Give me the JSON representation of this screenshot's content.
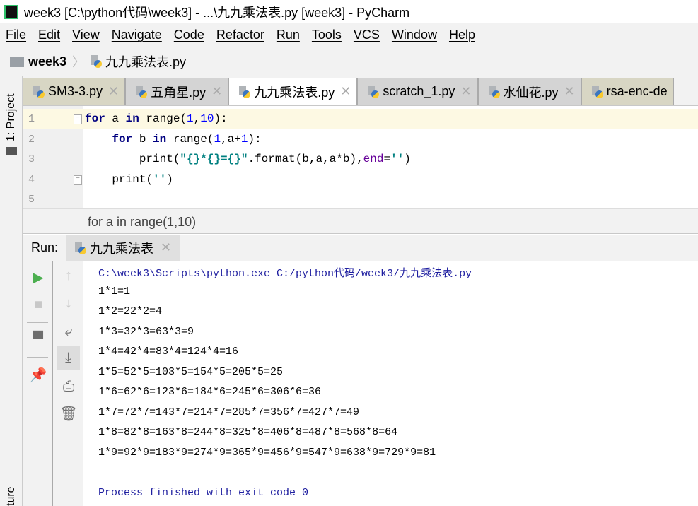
{
  "window": {
    "title": "week3 [C:\\python代码\\week3] - ...\\九九乘法表.py [week3] - PyCharm",
    "logo": "PC"
  },
  "menu": [
    "File",
    "Edit",
    "View",
    "Navigate",
    "Code",
    "Refactor",
    "Run",
    "Tools",
    "VCS",
    "Window",
    "Help"
  ],
  "breadcrumb": {
    "project": "week3",
    "file": "九九乘法表.py"
  },
  "left_strip": {
    "project": "1: Project",
    "structure": "ture"
  },
  "tabs": [
    {
      "label": "SM3-3.py"
    },
    {
      "label": "五角星.py"
    },
    {
      "label": "九九乘法表.py",
      "active": true
    },
    {
      "label": "scratch_1.py"
    },
    {
      "label": "水仙花.py"
    },
    {
      "label": "rsa-enc-de"
    }
  ],
  "editor": {
    "line_numbers": [
      "1",
      "2",
      "3",
      "4",
      "5"
    ]
  },
  "code_breadcrumb": "for a in range(1,10)",
  "run": {
    "label": "Run:",
    "tab": "九九乘法表"
  },
  "console": {
    "command": "C:\\week3\\Scripts\\python.exe C:/python代码/week3/九九乘法表.py",
    "lines": [
      "1*1=1",
      "1*2=22*2=4",
      "1*3=32*3=63*3=9",
      "1*4=42*4=83*4=124*4=16",
      "1*5=52*5=103*5=154*5=205*5=25",
      "1*6=62*6=123*6=184*6=245*6=306*6=36",
      "1*7=72*7=143*7=214*7=285*7=356*7=427*7=49",
      "1*8=82*8=163*8=244*8=325*8=406*8=487*8=568*8=64",
      "1*9=92*9=183*9=274*9=365*9=456*9=547*9=638*9=729*9=81"
    ],
    "exit": "Process finished with exit code 0"
  },
  "colors": {
    "keyword": "#000080",
    "number": "#0000ff",
    "string": "#008080",
    "named_param": "#660099",
    "run_green": "#4caf50",
    "console_info": "#1f1fa0"
  }
}
